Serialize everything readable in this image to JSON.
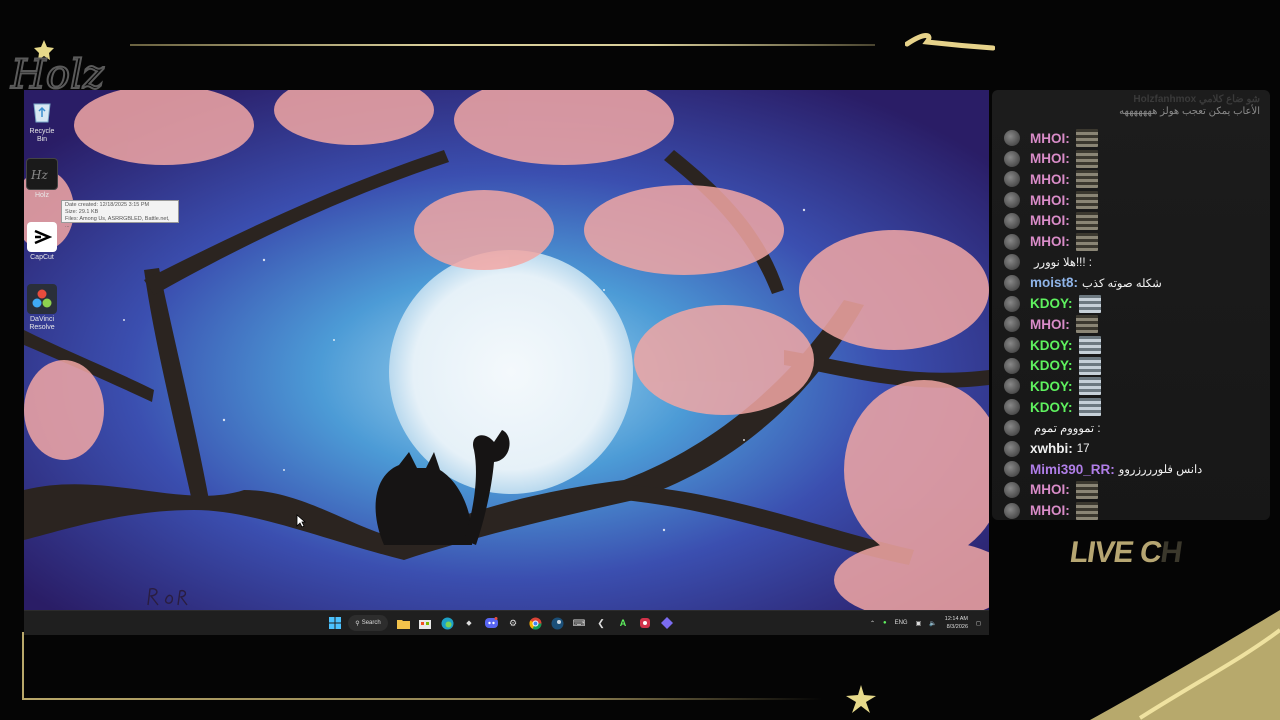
{
  "overlay": {
    "logo_text": "HOLZ",
    "accent_color": "#d9cf9a",
    "live_chat_main": "LIVE C",
    "live_chat_fade": "H"
  },
  "desktop": {
    "icons": [
      {
        "name": "recycle-bin",
        "label": "Recycle Bin"
      },
      {
        "name": "holz",
        "label": "Holz"
      },
      {
        "name": "capcut",
        "label": "CapCut"
      },
      {
        "name": "davinci-resolve",
        "label": "DaVinci Resolve"
      }
    ],
    "tooltip": {
      "line1": "Date created: 12/18/2025 3:15 PM",
      "line2": "Size: 29.1 KB",
      "line3": "Files: Among Us, ASRRGBLED, Battle.net, ..."
    }
  },
  "taskbar": {
    "search_label": "Search",
    "language": "ENG",
    "time": "12:14 AM",
    "date": "8/3/2026"
  },
  "chat": {
    "header_line1": "Holzfanhmox شو ضاع كلامي",
    "header_line2": "الأعاب يمكن تعجب هولز هههههههه",
    "messages": [
      {
        "user": "MHOI:",
        "color": "#d98cc8",
        "text": "",
        "emote": "dark"
      },
      {
        "user": "MHOI:",
        "color": "#d98cc8",
        "text": "",
        "emote": "dark"
      },
      {
        "user": "MHOI:",
        "color": "#d98cc8",
        "text": "",
        "emote": "dark"
      },
      {
        "user": "MHOI:",
        "color": "#d98cc8",
        "text": "",
        "emote": "dark"
      },
      {
        "user": "MHOI:",
        "color": "#d98cc8",
        "text": "",
        "emote": "dark"
      },
      {
        "user": "MHOI:",
        "color": "#d98cc8",
        "text": "",
        "emote": "dark"
      },
      {
        "user": "",
        "color": "#ffffff",
        "text": "هلا نوورر!!! :",
        "emote": ""
      },
      {
        "user": "moist8:",
        "color": "#8fb4e8",
        "text": "شكله صوته كذب",
        "emote": ""
      },
      {
        "user": "KDOY:",
        "color": "#5ff25f",
        "text": "",
        "emote": "light"
      },
      {
        "user": "MHOI:",
        "color": "#d98cc8",
        "text": "",
        "emote": "dark"
      },
      {
        "user": "KDOY:",
        "color": "#5ff25f",
        "text": "",
        "emote": "light"
      },
      {
        "user": "KDOY:",
        "color": "#5ff25f",
        "text": "",
        "emote": "light"
      },
      {
        "user": "KDOY:",
        "color": "#5ff25f",
        "text": "",
        "emote": "light"
      },
      {
        "user": "KDOY:",
        "color": "#5ff25f",
        "text": "",
        "emote": "light"
      },
      {
        "user": "",
        "color": "#ffffff",
        "text": "تموووم تموم :",
        "emote": ""
      },
      {
        "user": "xwhbi:",
        "color": "#f0f0f0",
        "text": "17",
        "emote": ""
      },
      {
        "user": "Mimi390_RR:",
        "color": "#b07ee8",
        "text": "دانس فلورررزروو",
        "emote": ""
      },
      {
        "user": "MHOI:",
        "color": "#d98cc8",
        "text": "",
        "emote": "dark"
      },
      {
        "user": "MHOI:",
        "color": "#d98cc8",
        "text": "",
        "emote": "dark"
      }
    ]
  }
}
